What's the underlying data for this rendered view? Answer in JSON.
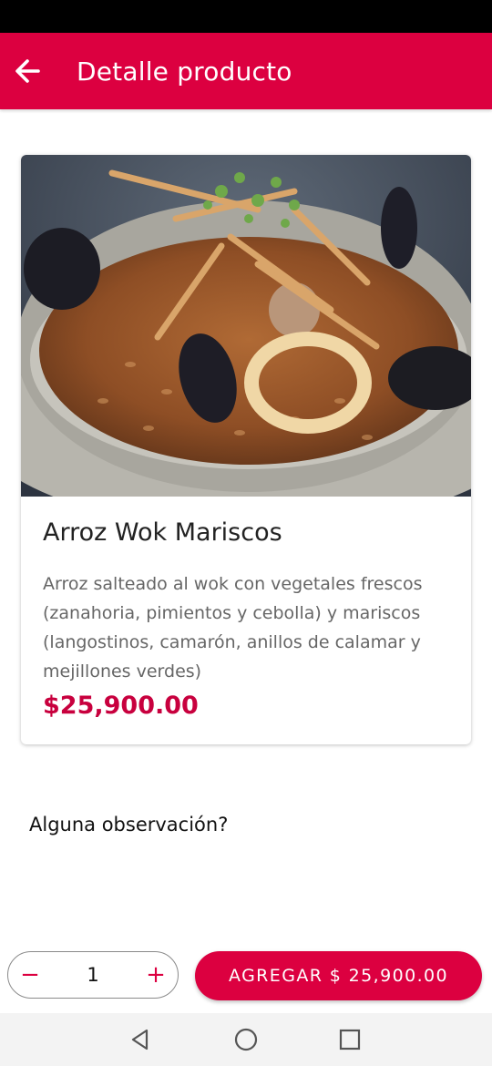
{
  "app_bar": {
    "title": "Detalle producto",
    "back_icon": "arrow-left-icon"
  },
  "product": {
    "name": "Arroz Wok Mariscos",
    "description": "Arroz salteado al wok con vegetales frescos (zanahoria, pimientos y cebolla) y mariscos (langostinos, camarón, anillos de calamar y mejillones verdes)",
    "price": "$25,900.00"
  },
  "observation": {
    "label": "Alguna observación?"
  },
  "stepper": {
    "minus": "−",
    "quantity": "1",
    "plus": "+"
  },
  "add_button": {
    "label": "AGREGAR $ 25,900.00"
  },
  "system_nav": {
    "back_icon": "triangle-back-icon",
    "home_icon": "circle-home-icon",
    "recents_icon": "square-recents-icon"
  },
  "colors": {
    "primary": "#dc0040",
    "price": "#c8003e"
  }
}
